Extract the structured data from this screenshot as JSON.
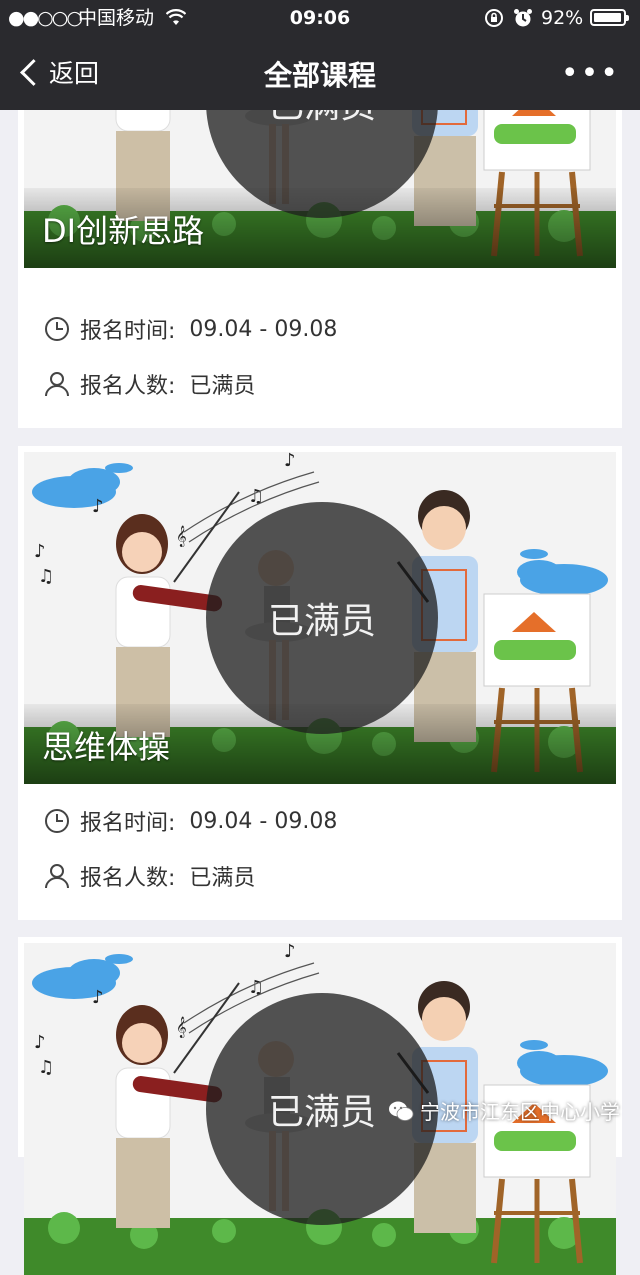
{
  "status_bar": {
    "signal": "●●○○○",
    "carrier": "中国移动",
    "time": "09:06",
    "battery": "92%"
  },
  "nav": {
    "back_label": "返回",
    "title": "全部课程",
    "more_label": "•••"
  },
  "courses": [
    {
      "name": "DI创新思路",
      "status": "已满员",
      "time_label": "报名时间:",
      "time_value": "09.04 - 09.08",
      "count_label": "报名人数:",
      "count_value": "已满员"
    },
    {
      "name": "思维体操",
      "status": "已满员",
      "time_label": "报名时间:",
      "time_value": "09.04 - 09.08",
      "count_label": "报名人数:",
      "count_value": "已满员"
    },
    {
      "name": "",
      "status": "已满员"
    }
  ],
  "watermark": "宁波市江东区中心小学",
  "colors": {
    "header_bg": "#2a2a2e",
    "page_bg": "#efeff4",
    "overlay": "#1e1e1e"
  }
}
